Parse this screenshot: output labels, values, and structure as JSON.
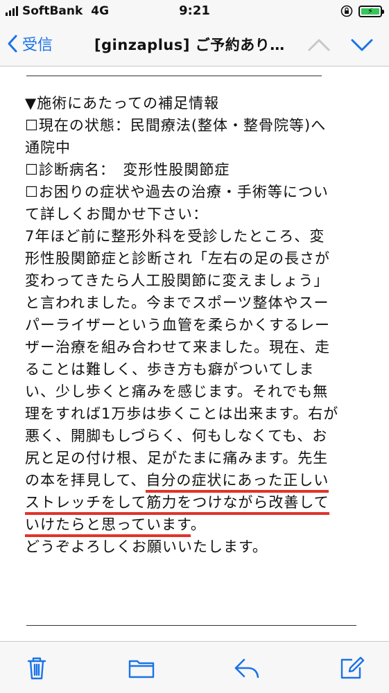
{
  "status_bar": {
    "carrier": "SoftBank",
    "network": "4G",
    "time": "9:21"
  },
  "nav": {
    "back_label": "受信",
    "title": "[ginzaplus] ご予約あり…"
  },
  "mail": {
    "lines": [
      "▼施術にあたっての補足情報",
      "☐現在の状態：民間療法(整体・整骨院等)へ",
      "通院中",
      "☐診断病名：　変形性股関節症",
      "☐お困りの症状や過去の治療・手術等につい",
      "て詳しくお聞かせ下さい：",
      "7年ほど前に整形外科を受診したところ、変",
      "形性股関節症と診断され「左右の足の長さが",
      "変わってきたら人工股関節に変えましょう」",
      "と言われました。今までスポーツ整体やスー",
      "パーライザーという血管を柔らかくするレー",
      "ザー治療を組み合わせて来ました。現在、走",
      "ることは難しく、歩き方も癖がついてしま",
      "い、少し歩くと痛みを感じます。それでも無",
      "理をすれば1万歩は歩くことは出来ます。右が",
      "悪く、開脚もしづらく、何もしなくても、お",
      "尻と足の付け根、足がたまに痛みます。先生"
    ],
    "line18_plain": "の本を拝見して、",
    "line18_underlined": "自分の症状にあった正しい",
    "line19_underlined": "ストレッチをして筋力をつけながら改善して",
    "line20_underlined": "いけたらと思っています",
    "line20_plain": "。",
    "closing": "どうぞよろしくお願いいたします。"
  },
  "colors": {
    "accent_blue": "#1a73e8",
    "underline_red": "#e0332a",
    "battery_green": "#34c759"
  },
  "icons": {
    "toolbar": [
      "trash-icon",
      "folder-icon",
      "reply-icon",
      "compose-icon"
    ]
  }
}
